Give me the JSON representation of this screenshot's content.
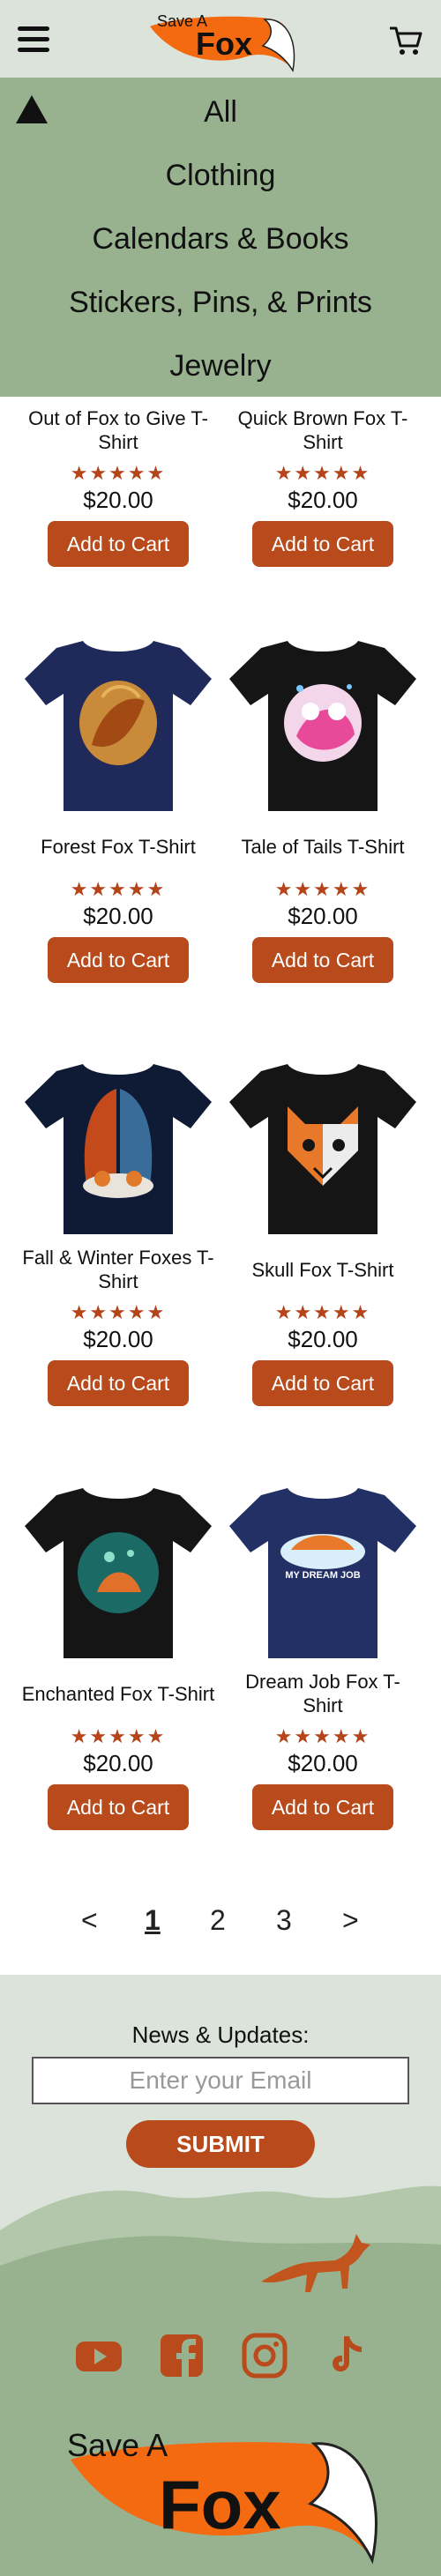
{
  "brand": {
    "logo_text_1": "Save A",
    "logo_text_2": "Fox"
  },
  "colors": {
    "accent": "#b84a1b",
    "nav_bg": "#98b28f",
    "header_bg": "#dce3db",
    "star": "#b5441a"
  },
  "nav": {
    "items": [
      "All",
      "Clothing",
      "Calendars & Books",
      "Stickers, Pins, & Prints",
      "Jewelry"
    ]
  },
  "products": [
    {
      "name": "Out of Fox to Give T-Shirt",
      "rating": 5,
      "stars": "★★★★★",
      "price": "$20.00",
      "button": "Add to Cart"
    },
    {
      "name": "Quick Brown Fox T-Shirt",
      "rating": 5,
      "stars": "★★★★★",
      "price": "$20.00",
      "button": "Add to Cart"
    },
    {
      "name": "Forest Fox T-Shirt",
      "rating": 5,
      "stars": "★★★★★",
      "price": "$20.00",
      "button": "Add to Cart"
    },
    {
      "name": "Tale of Tails T-Shirt",
      "rating": 5,
      "stars": "★★★★★",
      "price": "$20.00",
      "button": "Add to Cart"
    },
    {
      "name": "Fall & Winter Foxes T-Shirt",
      "rating": 5,
      "stars": "★★★★★",
      "price": "$20.00",
      "button": "Add to Cart"
    },
    {
      "name": "Skull Fox T-Shirt",
      "rating": 5,
      "stars": "★★★★★",
      "price": "$20.00",
      "button": "Add to Cart"
    },
    {
      "name": "Enchanted Fox T-Shirt",
      "rating": 5,
      "stars": "★★★★★",
      "price": "$20.00",
      "button": "Add to Cart"
    },
    {
      "name": "Dream Job Fox T-Shirt",
      "rating": 5,
      "stars": "★★★★★",
      "price": "$20.00",
      "button": "Add to Cart",
      "shirt_text": "MY DREAM JOB"
    }
  ],
  "pagination": {
    "prev": "<",
    "pages": [
      "1",
      "2",
      "3"
    ],
    "current": "1",
    "next": ">"
  },
  "newsletter": {
    "title": "News & Updates:",
    "email_placeholder": "Enter your Email",
    "submit_label": "SUBMIT"
  },
  "social": [
    "youtube-icon",
    "facebook-icon",
    "instagram-icon",
    "tiktok-icon"
  ]
}
